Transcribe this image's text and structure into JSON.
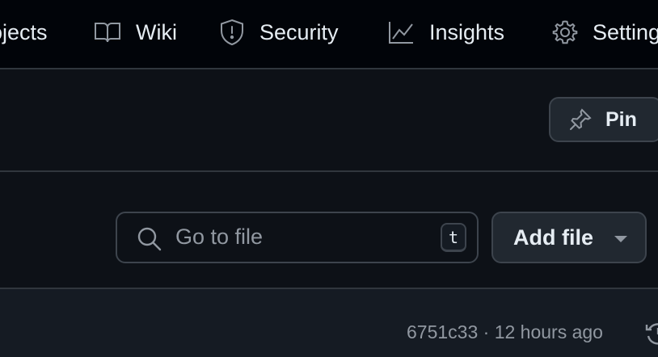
{
  "repo_nav": {
    "items": [
      {
        "label": "ojects",
        "icon": "projects-icon"
      },
      {
        "label": "Wiki",
        "icon": "book-icon"
      },
      {
        "label": "Security",
        "icon": "shield-icon"
      },
      {
        "label": "Insights",
        "icon": "graph-icon"
      },
      {
        "label": "Settings",
        "icon": "gear-icon"
      }
    ]
  },
  "header": {
    "pin_label": "Pin",
    "pin_icon": "pin-icon"
  },
  "file_toolbar": {
    "search_placeholder": "Go to file",
    "search_shortcut": "t",
    "add_file_label": "Add file"
  },
  "latest_commit": {
    "sha": "6751c33",
    "separator": "·",
    "time": "12 hours ago",
    "history_icon": "history-icon"
  },
  "colors": {
    "nav_bg": "#010409",
    "page_bg": "#0d1117",
    "button_bg": "#212830",
    "border": "#3d444d",
    "muted_text": "#9198a1",
    "text": "#e6edf3"
  }
}
